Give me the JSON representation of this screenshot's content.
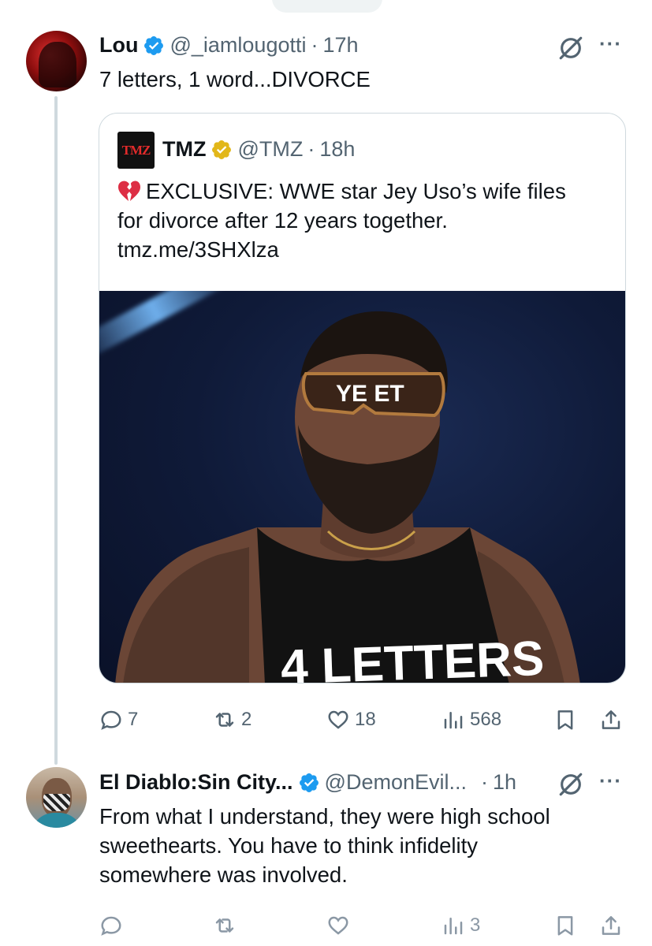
{
  "tweet1": {
    "name": "Lou",
    "handle": "@_iamlougotti",
    "separator": "·",
    "time": "17h",
    "text": "7 letters, 1 word...DIVORCE",
    "quote": {
      "logo_text": "TMZ",
      "name": "TMZ",
      "handle": "@TMZ",
      "separator": "·",
      "time": "18h",
      "text_line1": "EXCLUSIVE: WWE star Jey Uso’s wife files",
      "text_line2": "for divorce after 12 years together.",
      "text_line3": "tmz.me/3SHXlza",
      "image_glasses_text": "YE ET",
      "image_shirt_text": "4 LETTERS"
    },
    "actions": {
      "replies": "7",
      "reposts": "2",
      "likes": "18",
      "views": "568"
    }
  },
  "tweet2": {
    "name": "El Diablo:Sin City...",
    "handle": "@DemonEvil...",
    "separator": "·",
    "time": "1h",
    "text_line1": "From what I understand, they were high school",
    "text_line2": "sweethearts. You have to think infidelity",
    "text_line3": "somewhere was involved.",
    "actions": {
      "views": "3"
    }
  },
  "colors": {
    "verified_blue": "#1d9bf0",
    "verified_gold": "#e2b719",
    "muted_text": "#536471",
    "border": "#cfd9de"
  },
  "icons": [
    "grok-icon",
    "more-icon",
    "reply-icon",
    "repost-icon",
    "like-icon",
    "views-icon",
    "bookmark-icon",
    "share-icon",
    "verified-icon",
    "broken-heart-icon"
  ]
}
